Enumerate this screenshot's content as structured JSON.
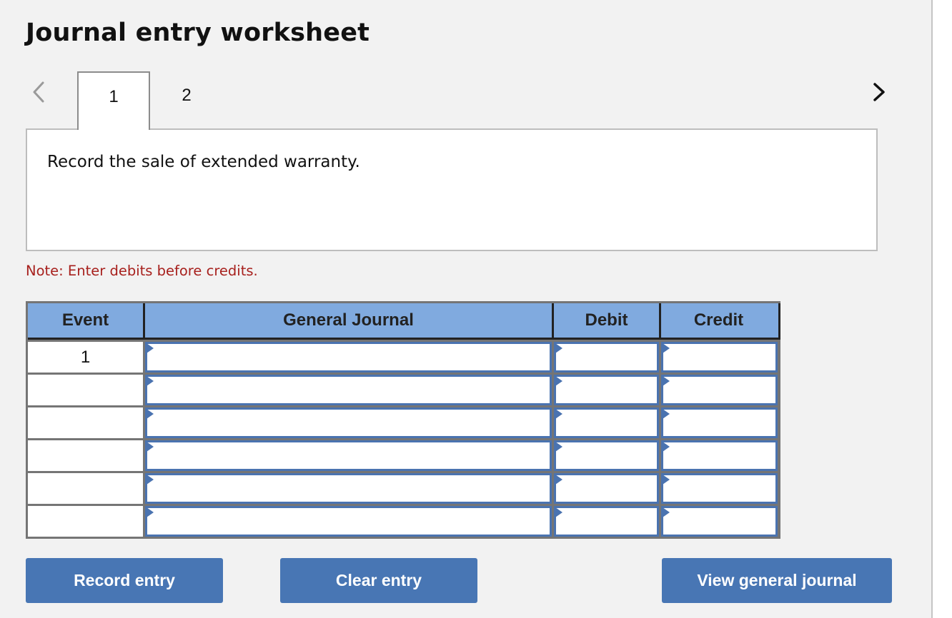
{
  "title": "Journal entry worksheet",
  "navigation": {
    "prev_icon": "chevron-left-icon",
    "next_icon": "chevron-right-icon",
    "prev_color": "#9a9a9a",
    "next_color": "#111111"
  },
  "tabs": [
    {
      "label": "1",
      "active": true
    },
    {
      "label": "2",
      "active": false
    }
  ],
  "description": "Record the sale of extended warranty.",
  "note": "Note: Enter debits before credits.",
  "table": {
    "headers": [
      "Event",
      "General Journal",
      "Debit",
      "Credit"
    ],
    "rows": [
      {
        "event": "1",
        "general_journal": "",
        "debit": "",
        "credit": ""
      },
      {
        "event": "",
        "general_journal": "",
        "debit": "",
        "credit": ""
      },
      {
        "event": "",
        "general_journal": "",
        "debit": "",
        "credit": ""
      },
      {
        "event": "",
        "general_journal": "",
        "debit": "",
        "credit": ""
      },
      {
        "event": "",
        "general_journal": "",
        "debit": "",
        "credit": ""
      },
      {
        "event": "",
        "general_journal": "",
        "debit": "",
        "credit": ""
      }
    ]
  },
  "buttons": {
    "record": "Record entry",
    "clear": "Clear entry",
    "view": "View general journal"
  },
  "colors": {
    "header_bg": "#80aadf",
    "button_bg": "#4876b4",
    "note_text": "#a7201d",
    "input_border": "#4a73b0"
  }
}
